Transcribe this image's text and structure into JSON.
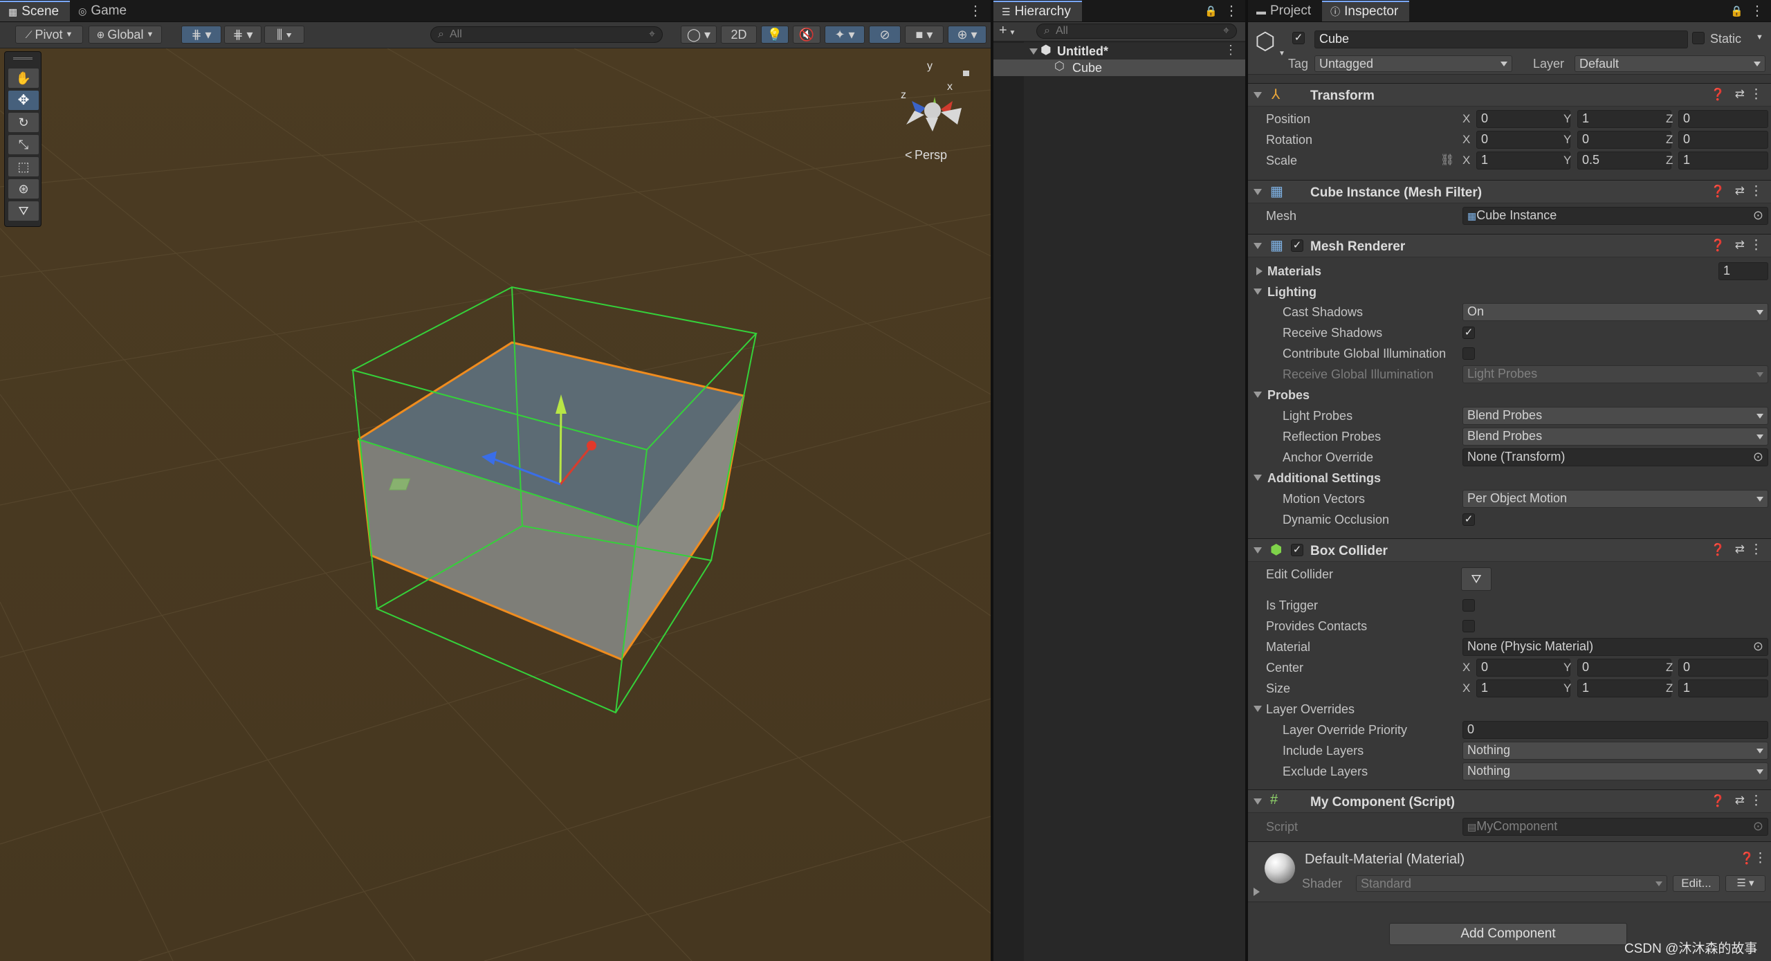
{
  "scene_panel": {
    "tabs": [
      {
        "label": "Scene"
      },
      {
        "label": "Game"
      }
    ],
    "toolbar": {
      "pivot_label": "Pivot",
      "global_label": "Global",
      "search_placeholder": "All",
      "mode_2d_label": "2D"
    },
    "gizmo": {
      "y_label": "y",
      "x_label": "x",
      "z_label": "z",
      "persp_label": "Persp"
    }
  },
  "hierarchy": {
    "tab_label": "Hierarchy",
    "search_placeholder": "All",
    "scene_name": "Untitled*",
    "items": [
      {
        "label": "Cube"
      }
    ]
  },
  "inspector": {
    "tabs": [
      {
        "label": "Project"
      },
      {
        "label": "Inspector"
      }
    ],
    "object_name": "Cube",
    "static_label": "Static",
    "tag_label": "Tag",
    "tag_value": "Untagged",
    "layer_label": "Layer",
    "layer_value": "Default",
    "transform": {
      "title": "Transform",
      "position_label": "Position",
      "position": {
        "x": "0",
        "y": "1",
        "z": "0"
      },
      "rotation_label": "Rotation",
      "rotation": {
        "x": "0",
        "y": "0",
        "z": "0"
      },
      "scale_label": "Scale",
      "scale": {
        "x": "1",
        "y": "0.5",
        "z": "1"
      }
    },
    "mesh_filter": {
      "title": "Cube Instance (Mesh Filter)",
      "mesh_label": "Mesh",
      "mesh_value": "Cube Instance"
    },
    "mesh_renderer": {
      "title": "Mesh Renderer",
      "materials_label": "Materials",
      "materials_count": "1",
      "lighting_label": "Lighting",
      "cast_shadows_label": "Cast Shadows",
      "cast_shadows_value": "On",
      "receive_shadows_label": "Receive Shadows",
      "receive_shadows_checked": true,
      "contribute_gi_label": "Contribute Global Illumination",
      "contribute_gi_checked": false,
      "receive_gi_label": "Receive Global Illumination",
      "receive_gi_value": "Light Probes",
      "probes_label": "Probes",
      "light_probes_label": "Light Probes",
      "light_probes_value": "Blend Probes",
      "reflection_probes_label": "Reflection Probes",
      "reflection_probes_value": "Blend Probes",
      "anchor_override_label": "Anchor Override",
      "anchor_override_value": "None (Transform)",
      "additional_label": "Additional Settings",
      "motion_vectors_label": "Motion Vectors",
      "motion_vectors_value": "Per Object Motion",
      "dynamic_occlusion_label": "Dynamic Occlusion",
      "dynamic_occlusion_checked": true
    },
    "box_collider": {
      "title": "Box Collider",
      "edit_collider_label": "Edit Collider",
      "is_trigger_label": "Is Trigger",
      "is_trigger_checked": false,
      "provides_contacts_label": "Provides Contacts",
      "provides_contacts_checked": false,
      "material_label": "Material",
      "material_value": "None (Physic Material)",
      "center_label": "Center",
      "center": {
        "x": "0",
        "y": "0",
        "z": "0"
      },
      "size_label": "Size",
      "size": {
        "x": "1",
        "y": "1",
        "z": "1"
      },
      "layer_overrides_label": "Layer Overrides",
      "priority_label": "Layer Override Priority",
      "priority_value": "0",
      "include_layers_label": "Include Layers",
      "include_layers_value": "Nothing",
      "exclude_layers_label": "Exclude Layers",
      "exclude_layers_value": "Nothing"
    },
    "my_component": {
      "title": "My Component (Script)",
      "script_label": "Script",
      "script_value": "MyComponent"
    },
    "material": {
      "title": "Default-Material (Material)",
      "shader_label": "Shader",
      "shader_value": "Standard",
      "edit_label": "Edit..."
    },
    "add_component_label": "Add Component",
    "axis_labels": {
      "x": "X",
      "y": "Y",
      "z": "Z"
    }
  },
  "watermark": "CSDN @沐沐森的故事"
}
